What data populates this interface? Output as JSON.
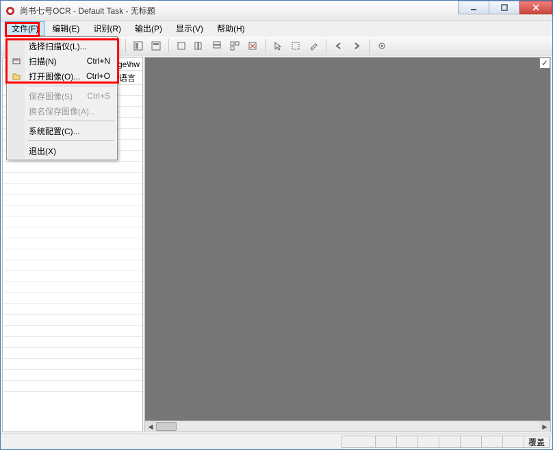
{
  "titlebar": {
    "title": "尚书七号OCR - Default Task - 无标题"
  },
  "menu": {
    "file": "文件(F)",
    "edit": "编辑(E)",
    "recognize": "识别(R)",
    "output": "输出(P)",
    "view": "显示(V)",
    "help": "帮助(H)"
  },
  "dropdown": {
    "select_scanner": "选择扫描仪(L)...",
    "scan": "扫描(N)",
    "scan_shortcut": "Ctrl+N",
    "open_image": "打开图像(O)...",
    "open_image_shortcut": "Ctrl+O",
    "save_image": "保存图像(S)",
    "save_image_shortcut": "Ctrl+S",
    "save_as_image": "换名保存图像(A)...",
    "system_config": "系统配置(C)...",
    "exit": "退出(X)"
  },
  "sidepanel": {
    "path_fragment": "ge\\hw",
    "language_label": "语言"
  },
  "viewer": {
    "checkbox_mark": "✓"
  },
  "statusbar": {
    "overwrite": "覆盖"
  }
}
